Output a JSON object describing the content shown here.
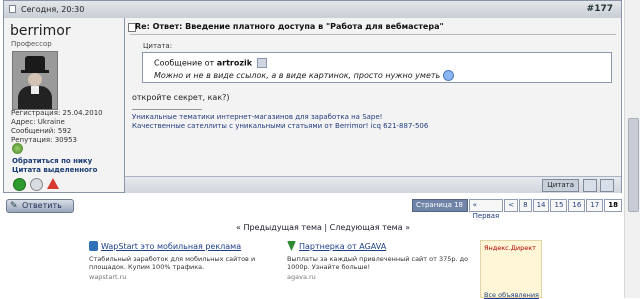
{
  "post": {
    "date": "Сегодня, 20:30",
    "number": "#177",
    "title": "Re: Ответ: Введение платного доступа в \"Работа для вебмастера\""
  },
  "user": {
    "name": "berrimor",
    "title": "Профессор",
    "info": [
      "Регистрация: 25.04.2010",
      "Адрес: Ukraine",
      "Сообщений: 592",
      "Репутация: 30953"
    ],
    "links": [
      "Обратиться по нику",
      "Цитата выделенного"
    ]
  },
  "quote": {
    "label": "Цитата:",
    "author_prefix": "Сообщение от",
    "author": "artrozik",
    "text": "Можно и не в виде ссылок, а в виде картинок, просто нужно уметь"
  },
  "message": "откройте секрет, как?)",
  "signature": [
    "Уникальные тематики интернет-магазинов для заработка на Sape!",
    "Качественные сателлиты с уникальными статьями от Berrimor! icq 621-887-506"
  ],
  "buttons": {
    "quote": "Цитата",
    "reply": "Ответить"
  },
  "pagination": {
    "status": "Страница 18 из 18",
    "first": "« Первая",
    "prev": "<",
    "pages": [
      "8",
      "14",
      "15",
      "16",
      "17",
      "18"
    ]
  },
  "thread_nav": "« Предыдущая тема | Следующая тема »",
  "ads": [
    {
      "title": "WapStart это мобильная реклама",
      "text": "Стабильный заработок для мобильных сайтов и площадок. Купим 100% трафика.",
      "url": "wapstart.ru"
    },
    {
      "title": "Партнерка от AGAVA",
      "text": "Выплаты за каждый привлеченный сайт от 375р. до 1000р. Узнайте больше!",
      "url": "agava.ru"
    }
  ],
  "direct": {
    "title": "Яндекс.Директ",
    "all": "Все объявления"
  }
}
